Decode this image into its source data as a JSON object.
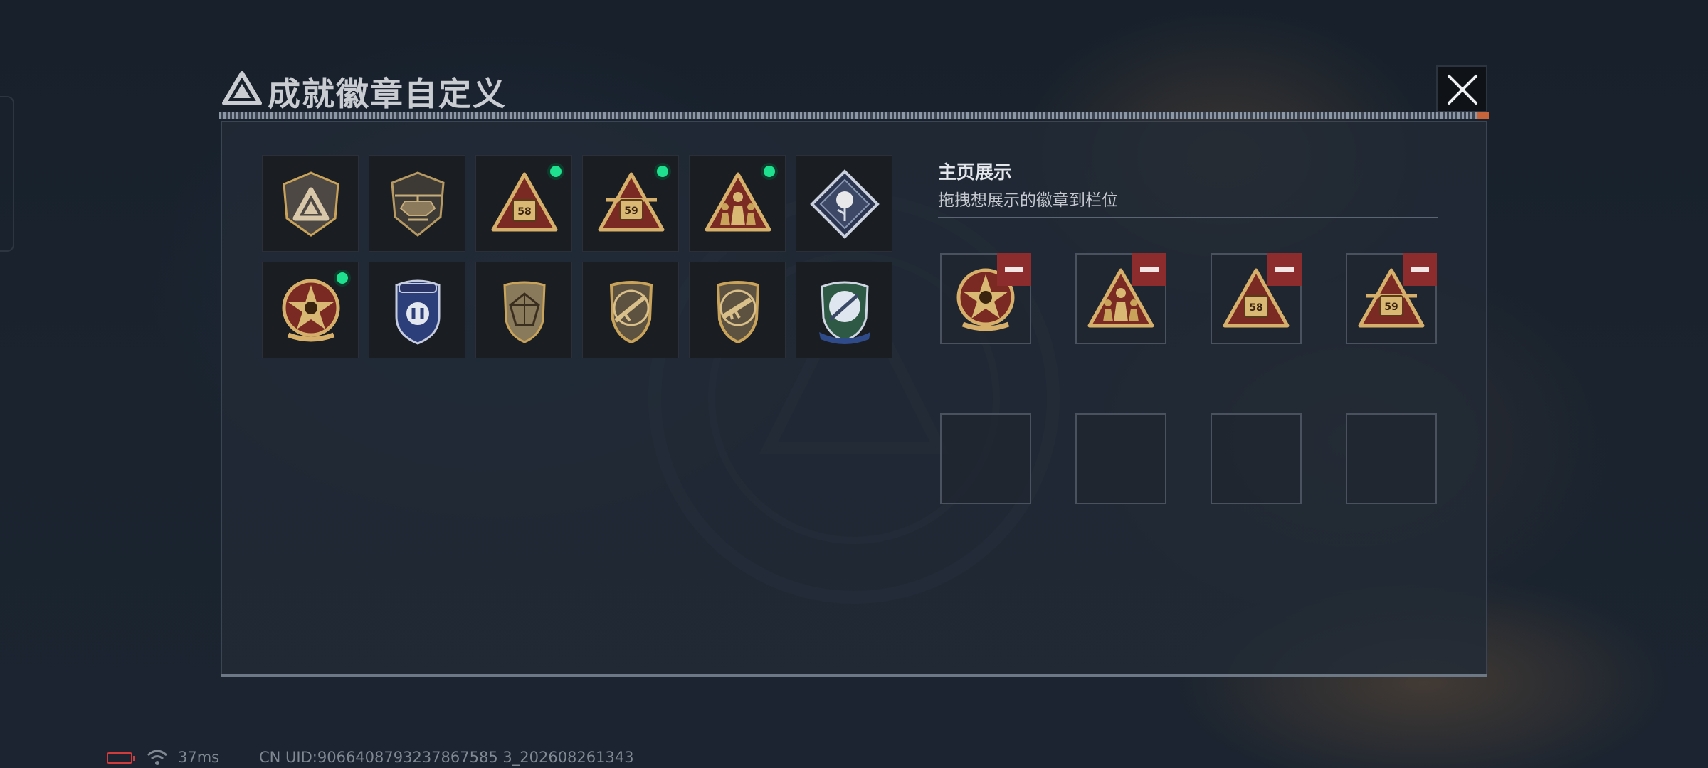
{
  "dialog": {
    "title": "成就徽章自定义",
    "close_icon": "close-icon"
  },
  "badge_grid": {
    "items": [
      {
        "icon": "triangle-shield-badge-icon",
        "new": false
      },
      {
        "icon": "helicopter-shield-badge-icon",
        "new": false
      },
      {
        "icon": "truck-58-triangle-badge-icon",
        "new": true
      },
      {
        "icon": "vehicle-59-triangle-badge-icon",
        "new": true
      },
      {
        "icon": "soldiers-triangle-badge-icon",
        "new": true
      },
      {
        "icon": "rose-diamond-badge-icon",
        "new": false
      },
      {
        "icon": "skull-star-medal-badge-icon",
        "new": true
      },
      {
        "icon": "blue-police-shield-badge-icon",
        "new": false
      },
      {
        "icon": "gem-shield-badge-icon",
        "new": false
      },
      {
        "icon": "rifle-shield-badge-icon",
        "new": false
      },
      {
        "icon": "smg-shield-badge-icon",
        "new": false
      },
      {
        "icon": "knife-crest-badge-icon",
        "new": false
      }
    ]
  },
  "showcase": {
    "title": "主页展示",
    "subtitle": "拖拽想展示的徽章到栏位",
    "slots": [
      {
        "icon": "skull-star-medal-badge-icon",
        "removable": true
      },
      {
        "icon": "soldiers-triangle-badge-icon",
        "removable": true
      },
      {
        "icon": "truck-58-triangle-badge-icon",
        "removable": true
      },
      {
        "icon": "vehicle-59-triangle-badge-icon",
        "removable": true
      },
      {
        "icon": null,
        "removable": false
      },
      {
        "icon": null,
        "removable": false
      },
      {
        "icon": null,
        "removable": false
      },
      {
        "icon": null,
        "removable": false
      }
    ],
    "remove_icon": "minus-icon"
  },
  "status_bar": {
    "ping": "37ms",
    "uid": "CN UID:9066408793237867585 3_202608261343",
    "battery_color": "#d23b3b"
  },
  "colors": {
    "accent_gold": "#c9a35a",
    "new_dot": "#1fe08f",
    "remove_red": "#8d2c2c"
  }
}
